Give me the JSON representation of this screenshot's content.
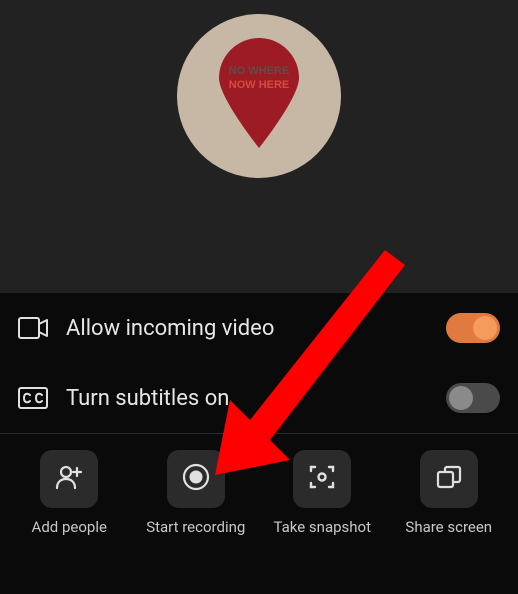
{
  "avatar": {
    "text_top": "NO WHERE",
    "text_bottom": "NOW HERE",
    "bg_color": "#C7B8A6",
    "pin_color": "#9c1b24"
  },
  "settings": {
    "incoming_video": {
      "label": "Allow incoming video",
      "enabled": true
    },
    "subtitles": {
      "label": "Turn subtitles on",
      "enabled": false
    }
  },
  "actions": {
    "add_people": {
      "label": "Add people"
    },
    "start_recording": {
      "label": "Start recording"
    },
    "take_snapshot": {
      "label": "Take snapshot"
    },
    "share_screen": {
      "label": "Share screen"
    }
  },
  "colors": {
    "toggle_on_track": "#E07A3F",
    "toggle_on_knob": "#F59B5C",
    "arrow": "#FF0000"
  }
}
